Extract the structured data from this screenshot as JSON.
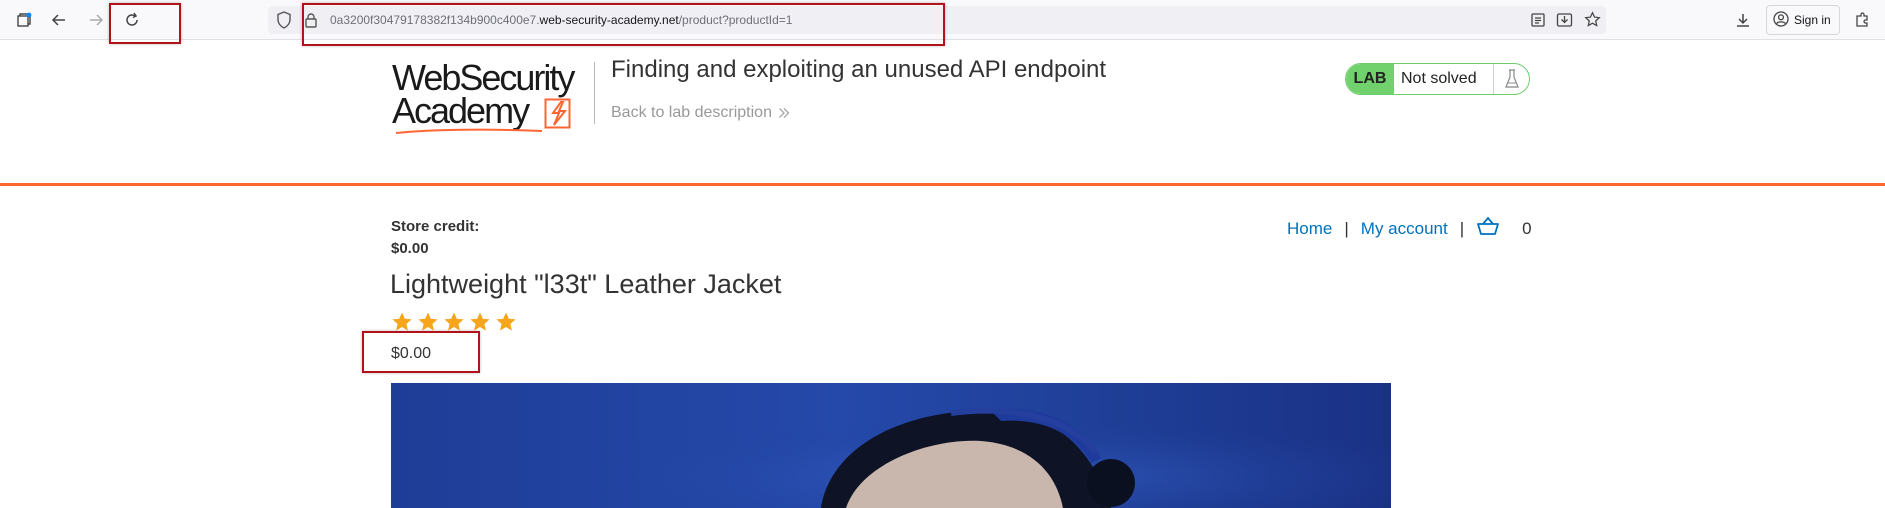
{
  "browser": {
    "url_prefix": "0a3200f30479178382f134b900c400e7.",
    "url_host": "web-security-academy.net",
    "url_path": "/product?productId=1",
    "sign_in_label": "Sign in",
    "icons": [
      "tab-manager-icon",
      "back-arrow-icon",
      "forward-arrow-icon",
      "reload-icon",
      "shield-icon",
      "lock-icon",
      "reader-view-icon",
      "save-page-icon",
      "bookmark-star-icon",
      "downloads-icon",
      "account-icon",
      "extensions-icon"
    ]
  },
  "header": {
    "logo_line1": "WebSecurity",
    "logo_line2": "Academy",
    "lab_title": "Finding and exploiting an unused API endpoint",
    "back_link": "Back to lab description",
    "lab_badge": "LAB",
    "lab_status": "Not solved"
  },
  "colors": {
    "accent_orange": "#ff6633",
    "link_blue": "#0071bc",
    "lab_green": "#70d16d",
    "star_gold": "#f7a51c",
    "annotation_red": "#b3121b"
  },
  "store": {
    "credit_label": "Store credit:",
    "credit_value": "$0.00"
  },
  "nav": {
    "home": "Home",
    "separator": "|",
    "my_account": "My account",
    "cart_count": "0"
  },
  "product": {
    "title": "Lightweight \"l33t\" Leather Jacket",
    "rating": 5,
    "rating_max": 5,
    "price": "$0.00"
  }
}
